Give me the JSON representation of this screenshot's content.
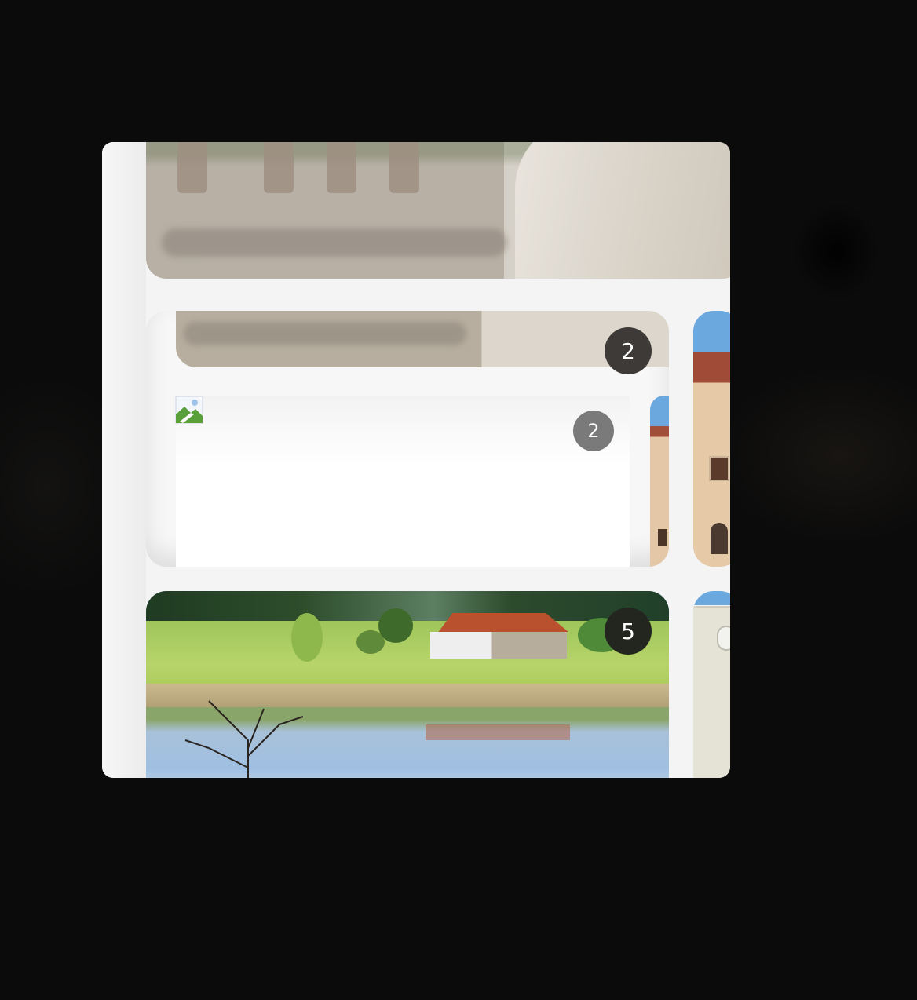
{
  "gallery": {
    "groups": [
      {
        "name": "blurred-photo-top",
        "count": null
      },
      {
        "name": "photo-set",
        "count": "2"
      },
      {
        "name": "stack-inner",
        "count": "2"
      },
      {
        "name": "landscape-album",
        "count": "5"
      }
    ]
  },
  "badges": {
    "mid_count": "2",
    "inner_count": "2",
    "landscape_count": "5"
  },
  "colors": {
    "page_background": "#0b0b0b",
    "window_background": "#f4f4f4",
    "badge_dark": "#2b2b2b",
    "badge_gray": "#7a7a7a"
  },
  "icons": [
    "broken-image-icon"
  ]
}
